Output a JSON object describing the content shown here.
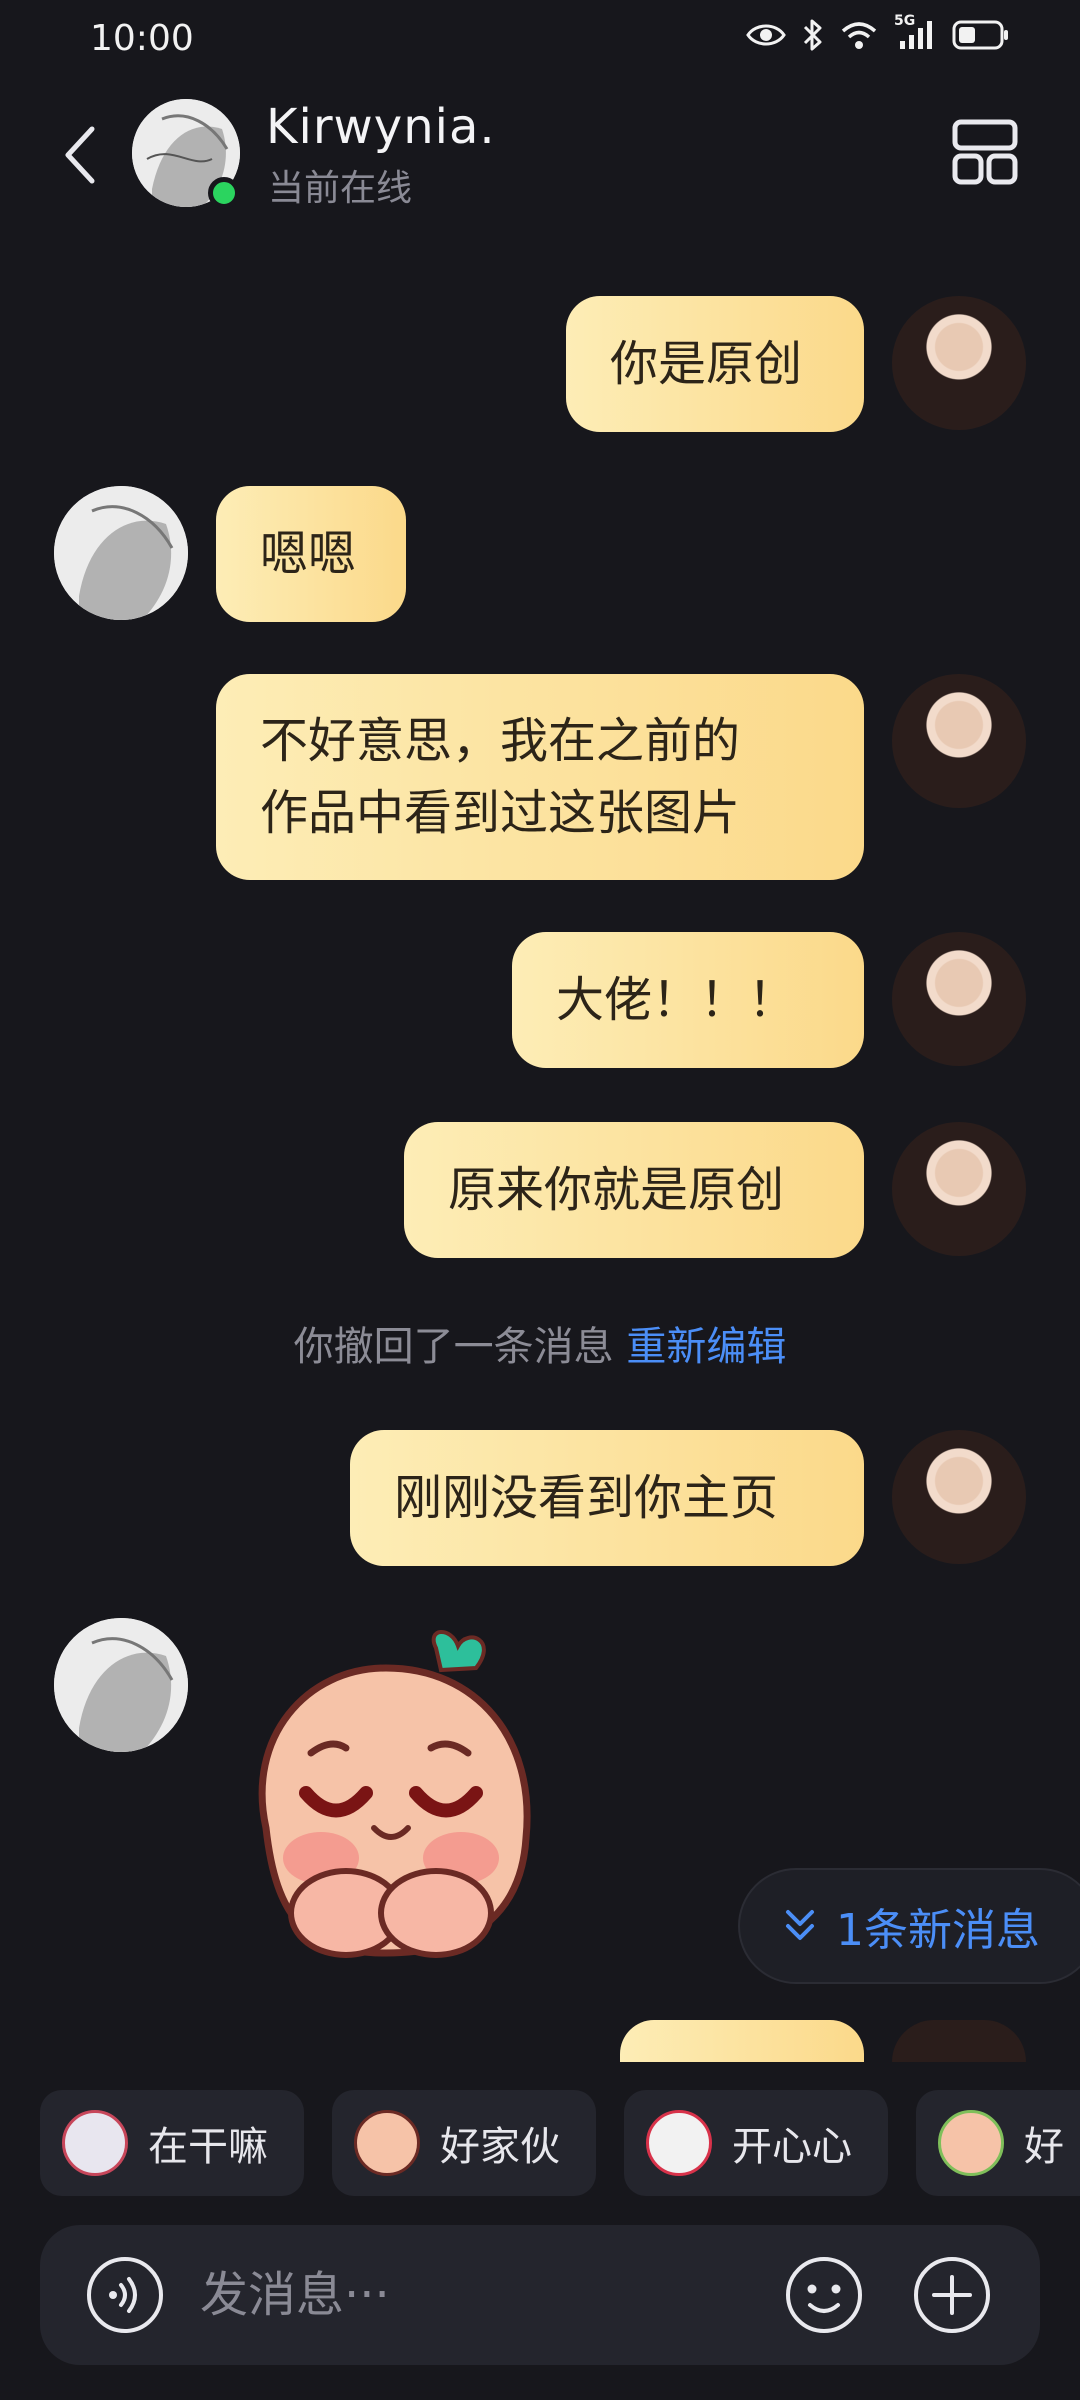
{
  "status_bar": {
    "time": "10:00",
    "network": "5G"
  },
  "header": {
    "contact_name": "Kirwynia.",
    "contact_status": "当前在线"
  },
  "messages": [
    {
      "side": "sent",
      "text": "你是原创"
    },
    {
      "side": "received",
      "text": "嗯嗯"
    },
    {
      "side": "sent",
      "text": "不好意思，我在之前的\n作品中看到过这张图片"
    },
    {
      "side": "sent",
      "text": "大佬！！！"
    },
    {
      "side": "sent",
      "text": "原来你就是原创"
    },
    {
      "side": "sent",
      "text": "刚刚没看到你主页"
    },
    {
      "side": "received",
      "sticker": "shy-peach-sticker"
    }
  ],
  "recall_notice": {
    "text": "你撤回了一条消息",
    "action": "重新编辑"
  },
  "new_message_pill": {
    "text": "1条新消息"
  },
  "quick_replies": [
    "在干嘛",
    "好家伙",
    "开心心",
    "好"
  ],
  "input": {
    "placeholder": "发消息···"
  },
  "colors": {
    "background": "#17171c",
    "bubble_start": "#fdedb6",
    "bubble_end": "#fbd98a",
    "link_blue": "#4b8ef7",
    "online_green": "#2bd45f"
  }
}
